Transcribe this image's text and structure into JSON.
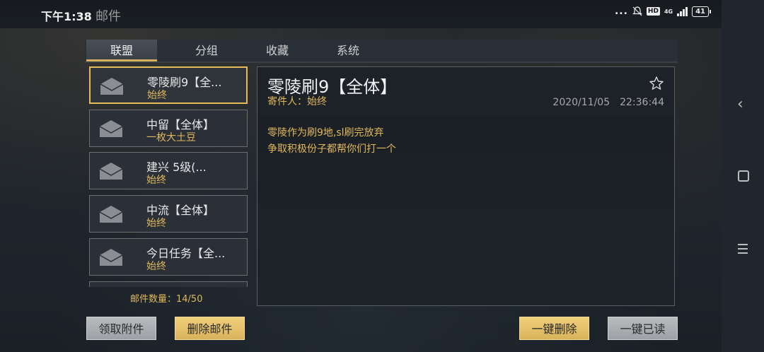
{
  "status_bar": {
    "time": "下午1:38",
    "app_name": "邮件",
    "dots": "...",
    "hd_badge": "HD",
    "network": "4G",
    "battery": "41"
  },
  "tabs": [
    {
      "label": "联盟",
      "active": true
    },
    {
      "label": "分组",
      "active": false
    },
    {
      "label": "收藏",
      "active": false
    },
    {
      "label": "系统",
      "active": false
    }
  ],
  "mail_list": [
    {
      "title": "零陵刷9【全...",
      "sender": "始终",
      "selected": true
    },
    {
      "title": "中留【全体】",
      "sender": "一枚大土豆",
      "selected": false
    },
    {
      "title": "建兴 5级(...",
      "sender": "始终",
      "selected": false
    },
    {
      "title": "中流【全体】",
      "sender": "始终",
      "selected": false
    },
    {
      "title": "今日任务【全...",
      "sender": "始终",
      "selected": false
    }
  ],
  "mail_count": "邮件数量：14/50",
  "detail": {
    "title": "零陵刷9【全体】",
    "sender_label": "寄件人：始终",
    "date": "2020/11/05　22:36:44",
    "body_lines": [
      "零陵作为刷9地,sl刷完放弃",
      "争取积极份子都帮你们打一个"
    ]
  },
  "buttons": {
    "claim": "领取附件",
    "delete": "删除邮件",
    "delete_all": "一键删除",
    "read_all": "一键已读"
  },
  "colors": {
    "accent_gold": "#e0b85a",
    "selected_border": "#e3bb57"
  }
}
